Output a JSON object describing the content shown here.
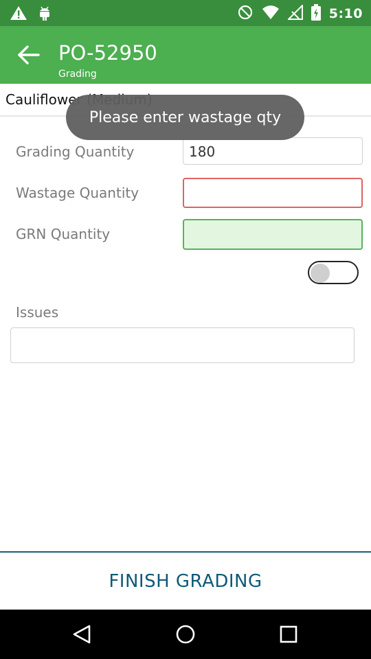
{
  "status_bar": {
    "time": "5:10",
    "icons": [
      "warning-icon",
      "android-icon",
      "dnd-icon",
      "wifi-icon",
      "signal-icon",
      "battery-icon"
    ]
  },
  "app_bar": {
    "title": "PO-52950",
    "subtitle": "Grading",
    "color": "#4caf50",
    "status_color": "#388e3c"
  },
  "product": {
    "name": "Cauliflower (Medium)"
  },
  "toast": {
    "message": "Please enter wastage qty"
  },
  "form": {
    "grading_label": "Grading Quantity",
    "grading_value": "180",
    "wastage_label": "Wastage Quantity",
    "wastage_value": "",
    "grn_label": "GRN Quantity",
    "grn_value": "",
    "toggle_on": false,
    "issues_label": "Issues",
    "issues_value": ""
  },
  "footer": {
    "finish_label": "FINISH GRADING",
    "accent": "#0f5a78"
  },
  "navbar": {
    "icons": [
      "back-triangle-icon",
      "home-circle-icon",
      "recents-square-icon"
    ]
  }
}
